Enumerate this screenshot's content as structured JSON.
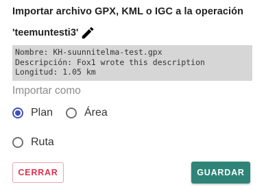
{
  "dialog": {
    "title": "Importar archivo GPX, KML o IGC a la operación",
    "operation_name": "'teemuntesti3'"
  },
  "file_info": {
    "name_line": "Nombre: KH-suunnitelma-test.gpx",
    "description_line": "Descripción: Fox1 wrote this description",
    "length_line": "Longitud: 1.05 km"
  },
  "import_as": {
    "label": "Importar como",
    "selected": "Plan",
    "options": [
      "Plan",
      "Área",
      "Ruta"
    ]
  },
  "actions": {
    "close_label": "CERRAR",
    "save_label": "GUARDAR"
  },
  "colors": {
    "accent": "#3f51b5",
    "save_button": "#2e8577",
    "close_text": "#e0304e"
  },
  "icons": {
    "edit": "pencil-icon"
  }
}
